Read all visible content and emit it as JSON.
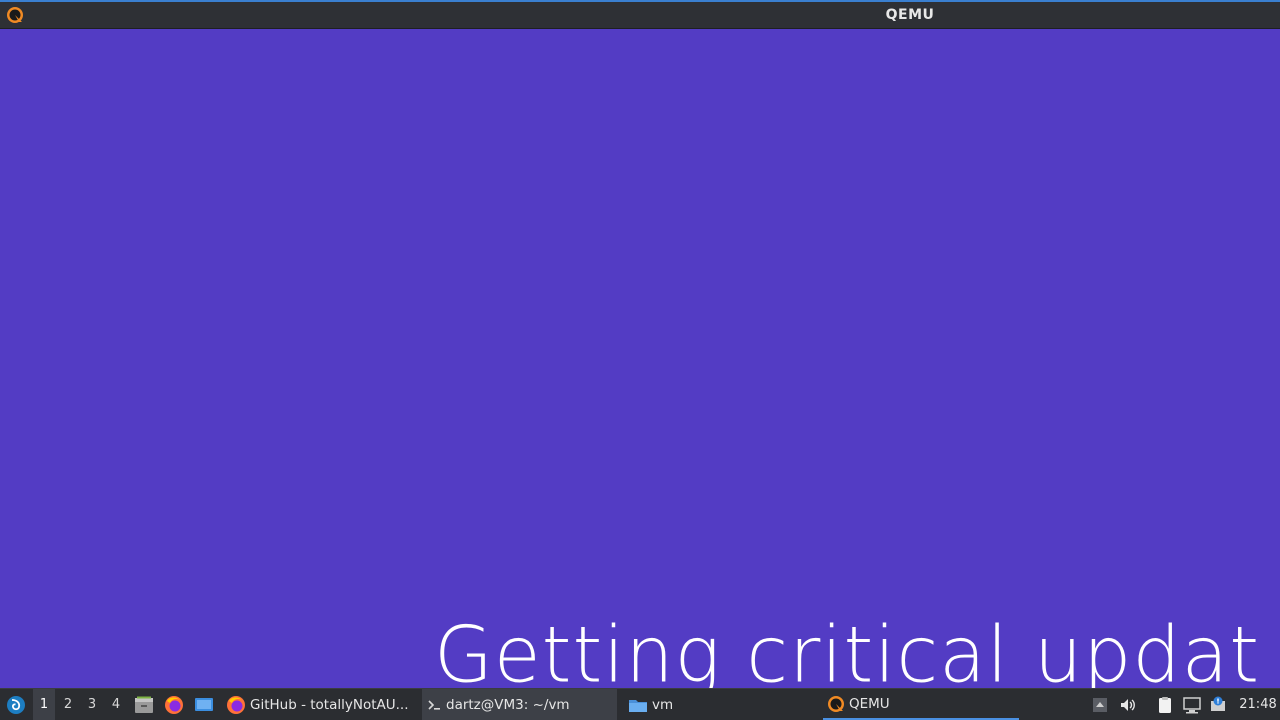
{
  "window": {
    "title": "QEMU",
    "icon": "qemu-icon"
  },
  "vm_screen": {
    "status_text": "Getting critical updat",
    "background_color": "#533cc4"
  },
  "taskbar": {
    "menu_icon": "start-menu-icon",
    "workspaces": [
      {
        "label": "1",
        "active": true
      },
      {
        "label": "2",
        "active": false
      },
      {
        "label": "3",
        "active": false
      },
      {
        "label": "4",
        "active": false
      }
    ],
    "launchers": [
      {
        "name": "file-manager-icon"
      },
      {
        "name": "firefox-icon"
      },
      {
        "name": "show-desktop-icon"
      }
    ],
    "tasks": [
      {
        "label": "GitHub - totallyNotAU...",
        "icon": "firefox-icon"
      },
      {
        "label": "dartz@VM3: ~/vm",
        "icon": "terminal-icon"
      },
      {
        "label": "vm",
        "icon": "folder-icon"
      },
      {
        "label": "QEMU",
        "icon": "qemu-icon"
      }
    ],
    "tray": [
      {
        "name": "tray-expand-icon"
      },
      {
        "name": "volume-icon"
      },
      {
        "name": "clipboard-icon"
      },
      {
        "name": "network-icon"
      },
      {
        "name": "notification-icon"
      }
    ],
    "clock": "21:48"
  }
}
